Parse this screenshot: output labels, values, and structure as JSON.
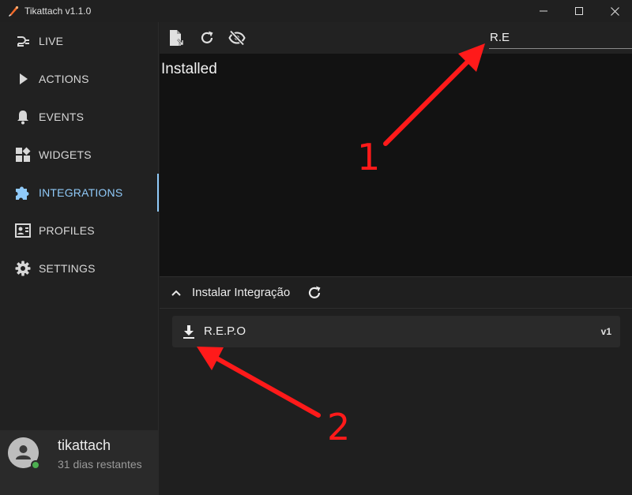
{
  "window": {
    "title": "Tikattach v1.1.0"
  },
  "sidebar": {
    "items": [
      {
        "label": "LIVE",
        "icon": "plug-icon"
      },
      {
        "label": "ACTIONS",
        "icon": "play-icon"
      },
      {
        "label": "EVENTS",
        "icon": "bell-icon"
      },
      {
        "label": "WIDGETS",
        "icon": "widgets-icon"
      },
      {
        "label": "INTEGRATIONS",
        "icon": "puzzle-icon",
        "active": true
      },
      {
        "label": "PROFILES",
        "icon": "profile-card-icon"
      },
      {
        "label": "SETTINGS",
        "icon": "gear-icon"
      }
    ],
    "user": {
      "name": "tikattach",
      "subtitle": "31 dias restantes",
      "status": "online"
    }
  },
  "toolbar": {
    "search_value": "R.E"
  },
  "installed": {
    "title": "Installed"
  },
  "install_section": {
    "title": "Instalar Integração",
    "expanded": true,
    "items": [
      {
        "name": "R.E.P.O",
        "version": "v1"
      }
    ]
  },
  "annotations": [
    {
      "label": "1"
    },
    {
      "label": "2"
    }
  ],
  "colors": {
    "accent": "#90caf9",
    "annotation": "#ff1a1a",
    "online": "#4caf50"
  }
}
